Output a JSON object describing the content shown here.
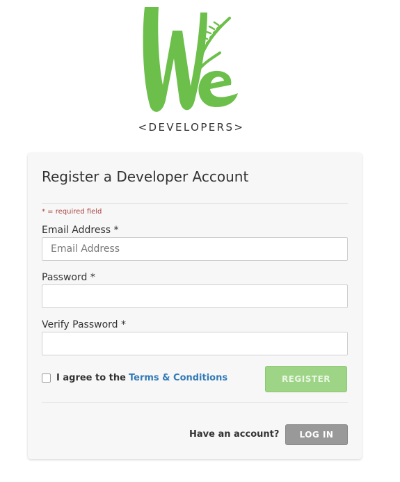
{
  "logo": {
    "mark_text": "We",
    "subtitle": "<DEVELOPERS>",
    "brand_color": "#6cbf4a"
  },
  "form": {
    "title": "Register a Developer Account",
    "required_note": "* = required field",
    "email": {
      "label": "Email Address *",
      "placeholder": "Email Address",
      "value": ""
    },
    "password": {
      "label": "Password *",
      "value": ""
    },
    "verify_password": {
      "label": "Verify Password *",
      "value": ""
    },
    "agree": {
      "prefix": "I agree to the",
      "link_text": "Terms & Conditions",
      "checked": false
    },
    "register_button": "REGISTER",
    "have_account_text": "Have an account?",
    "login_button": "LOG IN"
  },
  "colors": {
    "accent_green": "#9ed486",
    "link_blue": "#337ab7",
    "required_red": "#a94442",
    "login_gray": "#999999"
  }
}
